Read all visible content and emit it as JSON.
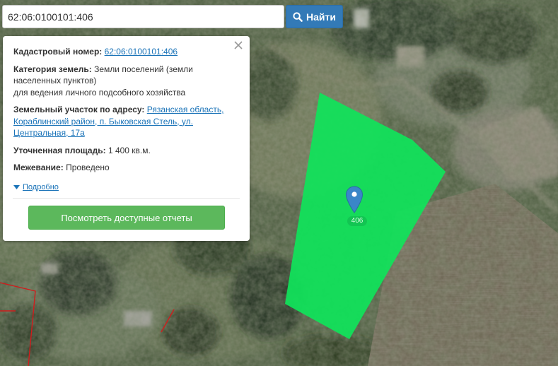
{
  "search": {
    "value": "62:06:0100101:406",
    "button_label": "Найти"
  },
  "popup": {
    "cadastral_label": "Кадастровый номер:",
    "cadastral_value": "62:06:0100101:406",
    "category_label": "Категория земель:",
    "category_value_line1": "Земли поселений (земли",
    "category_value_line2": "населенных пунктов)",
    "category_value_line3": "для ведения личного подсобного хозяйства",
    "address_label": "Земельный участок по адресу:",
    "address_part1": "Рязанская область,",
    "address_part2": "Кораблинский район, п. Быковская Стель, ул.",
    "address_part3": "Центральная, 17а",
    "area_label": "Уточненная площадь:",
    "area_value": "1 400 кв.м.",
    "survey_label": "Межевание:",
    "survey_value": "Проведено",
    "more_label": "Подробно",
    "reports_button": "Посмотреть доступные отчеты"
  },
  "map": {
    "parcel_number": "406",
    "parcel_color": "#10e35a",
    "marker_color": "#3a86c8",
    "boundary_color": "#d01c1c",
    "icons": [
      "search-icon",
      "close-icon",
      "caret-down-icon",
      "map-pin-icon"
    ]
  }
}
